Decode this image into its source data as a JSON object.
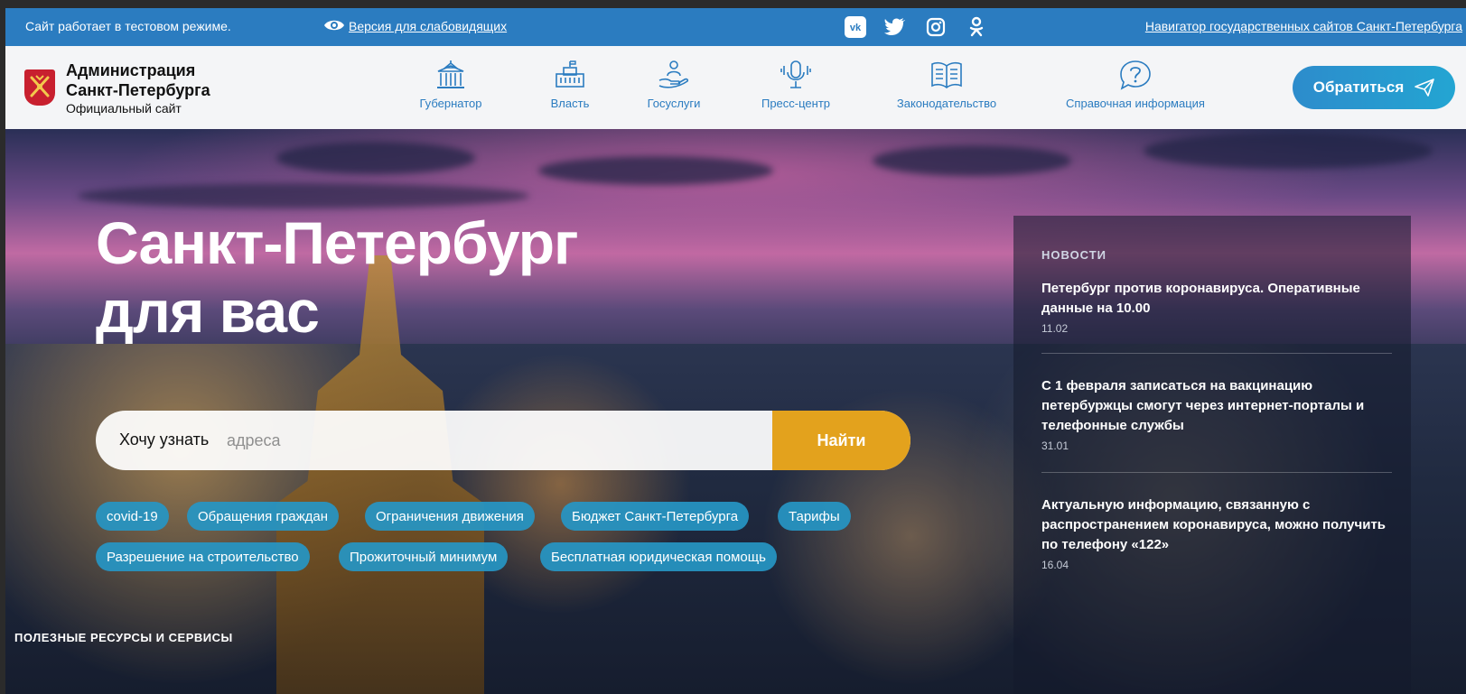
{
  "topbar": {
    "test_mode": "Сайт работает в тестовом режиме.",
    "low_vision": "Версия для слабовидящих",
    "social": [
      "vk",
      "twitter",
      "instagram",
      "odnoklassniki"
    ],
    "navigator": "Навигатор государственных сайтов Санкт-Петербурга"
  },
  "logo": {
    "line1": "Администрация",
    "line2": "Санкт-Петербурга",
    "line3": "Официальный сайт"
  },
  "nav": [
    {
      "label": "Губернатор",
      "icon": "building-columns-icon"
    },
    {
      "label": "Власть",
      "icon": "government-building-icon"
    },
    {
      "label": "Госуслуги",
      "icon": "person-hand-icon"
    },
    {
      "label": "Пресс-центр",
      "icon": "microphone-icon"
    },
    {
      "label": "Законодательство",
      "icon": "open-book-icon"
    },
    {
      "label": "Справочная информация",
      "icon": "question-bubble-icon"
    }
  ],
  "contact_button": "Обратиться",
  "hero": {
    "title_line1": "Санкт-Петербург",
    "title_line2": "для вас"
  },
  "search": {
    "prefix": "Хочу узнать",
    "placeholder": "адреса",
    "button": "Найти"
  },
  "tags_row1": [
    "covid-19",
    "Обращения граждан",
    "Ограничения движения",
    "Бюджет Санкт-Петербурга",
    "Тарифы"
  ],
  "tags_row2": [
    "Разрешение на строительство",
    "Прожиточный минимум",
    "Бесплатная юридическая помощь"
  ],
  "resources_heading": "ПОЛЕЗНЫЕ РЕСУРСЫ И СЕРВИСЫ",
  "news": {
    "heading": "НОВОСТИ",
    "items": [
      {
        "title": "Петербург против коронавируса. Оперативные данные на 10.00",
        "date": "11.02"
      },
      {
        "title": "С 1 февраля записаться на вакцинацию петербуржцы смогут через интернет-порталы и телефонные службы",
        "date": "31.01"
      },
      {
        "title": "Актуальную информацию, связанную с распространением коронавируса, можно получить по телефону «122»",
        "date": "16.04"
      }
    ]
  },
  "colors": {
    "topbar": "#2b7cc0",
    "accent": "#2b7cc0",
    "find_button": "#e3a21d",
    "tag": "#2696c4",
    "emblem": "#c8202f"
  }
}
